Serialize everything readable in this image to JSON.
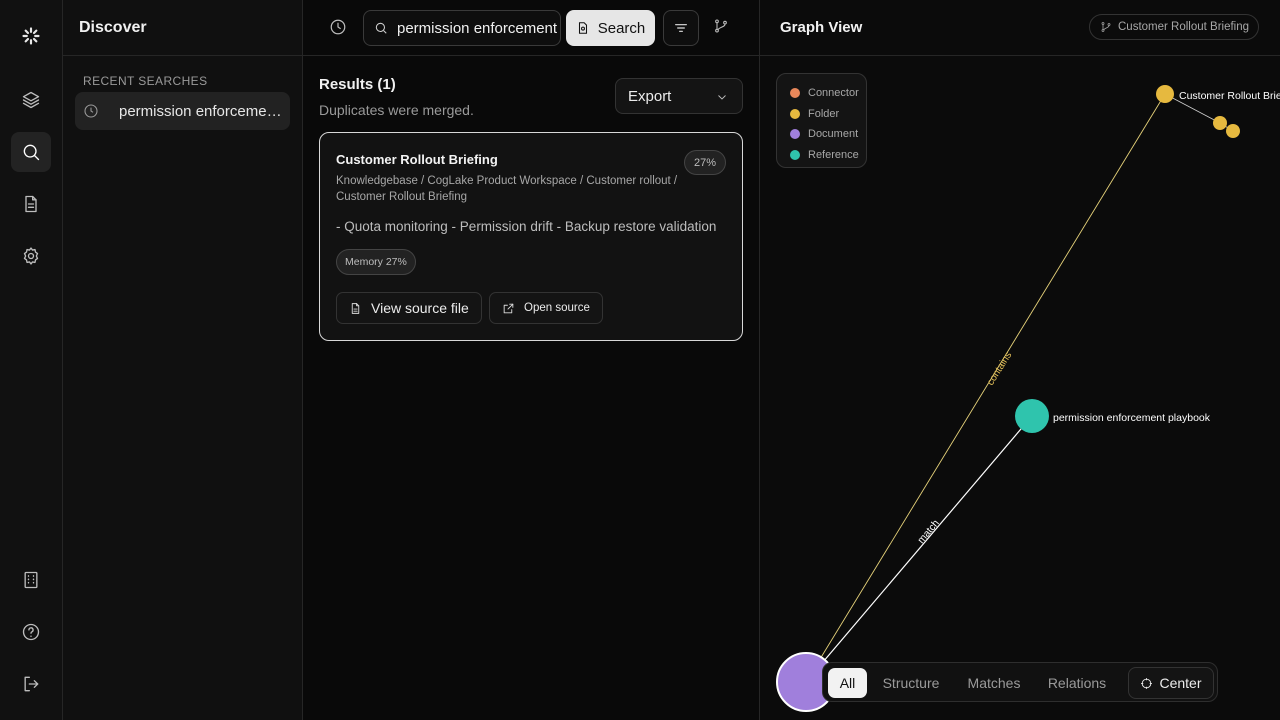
{
  "discover": {
    "title": "Discover",
    "recent_heading": "RECENT SEARCHES",
    "recent_items": [
      {
        "label": "permission enforcement playbook"
      }
    ]
  },
  "toolbar": {
    "search_value": "permission enforcement playbook",
    "search_button": "Search"
  },
  "results": {
    "title": "Results (1)",
    "subtitle": "Duplicates were merged.",
    "export_label": "Export",
    "cards": [
      {
        "title": "Customer Rollout Briefing",
        "score": "27%",
        "path": "Knowledgebase / CogLake Product Workspace / Customer rollout / Customer Rollout Briefing",
        "snippet": "- Quota monitoring - Permission drift - Backup restore validation",
        "badge": "Memory 27%",
        "view_label": "View source file",
        "open_label": "Open source"
      }
    ]
  },
  "graph": {
    "title": "Graph View",
    "context_pill": "Customer Rollout Briefing",
    "legend": [
      {
        "label": "Connector",
        "color": "#e8875a"
      },
      {
        "label": "Folder",
        "color": "#e6b93f"
      },
      {
        "label": "Document",
        "color": "#a07fdc"
      },
      {
        "label": "Reference",
        "color": "#2fc4ad"
      }
    ],
    "nodes": [
      {
        "id": "doc",
        "type": "Document",
        "label": ""
      },
      {
        "id": "folder",
        "type": "Folder",
        "label": "Customer Rollout Briefing"
      },
      {
        "id": "f2",
        "type": "Folder",
        "label": ""
      },
      {
        "id": "f3",
        "type": "Folder",
        "label": ""
      },
      {
        "id": "ref",
        "type": "Reference",
        "label": "permission enforcement playbook"
      }
    ],
    "edges": [
      {
        "label": "contains",
        "color": "#e6d27a"
      },
      {
        "label": "match",
        "color": "#ffffff"
      }
    ],
    "tabs": [
      "All",
      "Structure",
      "Matches",
      "Relations"
    ],
    "active_tab": "All",
    "center_label": "Center"
  }
}
